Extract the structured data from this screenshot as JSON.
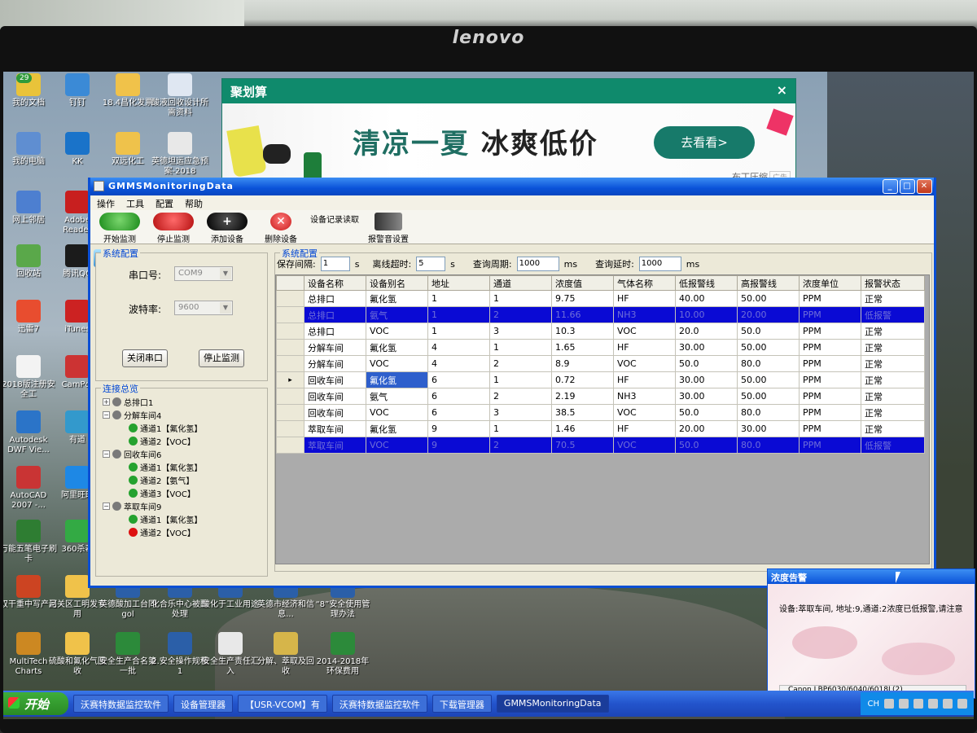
{
  "monitor": {
    "brand": "lenovo"
  },
  "desktop_icons": [
    {
      "label": "我的文档",
      "icon": "documents-icon",
      "badge": "29"
    },
    {
      "label": "钉钉",
      "icon": "dingtalk-icon"
    },
    {
      "label": "18.4昌化发票",
      "icon": "folder-icon"
    },
    {
      "label": "酸液回收设计所需资料",
      "icon": "word-doc-icon"
    },
    {
      "label": "我的电脑",
      "icon": "computer-icon"
    },
    {
      "label": "KK",
      "icon": "kk-icon"
    },
    {
      "label": "双远化工",
      "icon": "folder-icon"
    },
    {
      "label": "英德坦运应急预案-2018",
      "icon": "text-doc-icon"
    },
    {
      "label": "网上邻居",
      "icon": "network-icon"
    },
    {
      "label": "Adobe Reader",
      "icon": "pdf-icon"
    },
    {
      "label": "回收站",
      "icon": "recycle-bin-icon"
    },
    {
      "label": "腾讯QQ",
      "icon": "qq-icon"
    },
    {
      "label": "迅雷7",
      "icon": "xunlei-icon"
    },
    {
      "label": "iTunes",
      "icon": "music-icon"
    },
    {
      "label": "2018版注册安全工",
      "icon": "exam-icon"
    },
    {
      "label": "CamPdf",
      "icon": "printer-icon"
    },
    {
      "label": "Autodesk DWF Vie...",
      "icon": "autodesk-icon"
    },
    {
      "label": "有道",
      "icon": "youdao-icon"
    },
    {
      "label": "AutoCAD 2007 -...",
      "icon": "autocad-icon"
    },
    {
      "label": "阿里旺旺",
      "icon": "aliwangwang-icon"
    },
    {
      "label": "万能五笔电子刷卡",
      "icon": "wubi-icon"
    },
    {
      "label": "360杀毒",
      "icon": "antivirus-icon"
    },
    {
      "label": "双干重中写产品",
      "icon": "app-icon"
    },
    {
      "label": "河关区工明发专用",
      "icon": "folder-icon"
    },
    {
      "label": "英德酸加工台同gol",
      "icon": "word-doc-icon"
    },
    {
      "label": "化合乐中心被酸处理",
      "icon": "word-doc-icon"
    },
    {
      "label": "酸化于工业用途",
      "icon": "word-doc-icon"
    },
    {
      "label": "英德市经济和信息...",
      "icon": "word-doc-icon"
    },
    {
      "label": "“8”安全使用管理办法",
      "icon": "word-doc-icon"
    },
    {
      "label": "MultiTech Charts",
      "icon": "chart-app-icon"
    },
    {
      "label": "硫酸和氟化气回收",
      "icon": "folder-icon"
    },
    {
      "label": "安全生产合名第一批",
      "icon": "excel-icon"
    },
    {
      "label": "2.安全操作规程1",
      "icon": "word-doc-icon"
    },
    {
      "label": "安全生产责任汇入",
      "icon": "text-doc-icon"
    },
    {
      "label": "分解、萃取及回收",
      "icon": "dwg-icon"
    },
    {
      "label": "2014-2018年环保费用",
      "icon": "excel-icon"
    }
  ],
  "ad": {
    "brand": "聚划算",
    "headline_green": "清凉一夏",
    "headline_dark": "冰爽低价",
    "button": "去看看>",
    "footer": "布丁压缩",
    "badge": "广告"
  },
  "app": {
    "title": "GMMSMonitoringData",
    "menu": [
      "操作",
      "工具",
      "配置",
      "帮助"
    ],
    "toolbar": [
      {
        "label": "开始监测",
        "icon": "start-monitor-icon"
      },
      {
        "label": "停止监测",
        "icon": "stop-monitor-icon"
      },
      {
        "label": "添加设备",
        "icon": "add-device-icon"
      },
      {
        "label": "删除设备",
        "icon": "delete-device-icon"
      },
      {
        "label": "设备记录读取",
        "icon": "record-read-icon"
      },
      {
        "label": "报警音设置",
        "icon": "alarm-sound-icon"
      }
    ],
    "left_config": {
      "title": "系统配置",
      "port_label": "串口号:",
      "port_value": "COM9",
      "baud_label": "波特率:",
      "baud_value": "9600",
      "close_port_btn": "关闭串口",
      "stop_monitor_btn": "停止监测"
    },
    "tree": {
      "title": "连接总览",
      "nodes": [
        {
          "level": 1,
          "label": "总排口1",
          "status": "gray",
          "expander": "+"
        },
        {
          "level": 1,
          "label": "分解车间4",
          "status": "gray",
          "expander": "−"
        },
        {
          "level": 3,
          "label": "通道1【氟化氢】",
          "status": "green"
        },
        {
          "level": 3,
          "label": "通道2【VOC】",
          "status": "green"
        },
        {
          "level": 1,
          "label": "回收车间6",
          "status": "gray",
          "expander": "−"
        },
        {
          "level": 3,
          "label": "通道1【氟化氢】",
          "status": "green"
        },
        {
          "level": 3,
          "label": "通道2【氨气】",
          "status": "green"
        },
        {
          "level": 3,
          "label": "通道3【VOC】",
          "status": "green"
        },
        {
          "level": 1,
          "label": "萃取车间9",
          "status": "gray",
          "expander": "−"
        },
        {
          "level": 3,
          "label": "通道1【氟化氢】",
          "status": "green"
        },
        {
          "level": 3,
          "label": "通道2【VOC】",
          "status": "red"
        }
      ]
    },
    "sys_config": {
      "title": "系统配置",
      "save_interval_label": "保存间隔:",
      "save_interval": "1",
      "save_unit": "s",
      "offline_label": "离线超时:",
      "offline": "5",
      "offline_unit": "s",
      "query_period_label": "查询周期:",
      "query_period": "1000",
      "query_period_unit": "ms",
      "query_delay_label": "查询延时:",
      "query_delay": "1000",
      "query_delay_unit": "ms"
    },
    "table": {
      "columns": [
        "设备名称",
        "设备别名",
        "地址",
        "通道",
        "浓度值",
        "气体名称",
        "低报警线",
        "高报警线",
        "浓度单位",
        "报警状态"
      ],
      "rows": [
        [
          "总排口",
          "氟化氢",
          "1",
          "1",
          "9.75",
          "HF",
          "40.00",
          "50.00",
          "PPM",
          "正常"
        ],
        [
          "总排口",
          "氨气",
          "1",
          "2",
          "11.66",
          "NH3",
          "10.00",
          "20.00",
          "PPM",
          "低报警"
        ],
        [
          "总排口",
          "VOC",
          "1",
          "3",
          "10.3",
          "VOC",
          "20.0",
          "50.0",
          "PPM",
          "正常"
        ],
        [
          "分解车间",
          "氟化氢",
          "4",
          "1",
          "1.65",
          "HF",
          "30.00",
          "50.00",
          "PPM",
          "正常"
        ],
        [
          "分解车间",
          "VOC",
          "4",
          "2",
          "8.9",
          "VOC",
          "50.0",
          "80.0",
          "PPM",
          "正常"
        ],
        [
          "回收车间",
          "氟化氢",
          "6",
          "1",
          "0.72",
          "HF",
          "30.00",
          "50.00",
          "PPM",
          "正常"
        ],
        [
          "回收车间",
          "氨气",
          "6",
          "2",
          "2.19",
          "NH3",
          "30.00",
          "50.00",
          "PPM",
          "正常"
        ],
        [
          "回收车间",
          "VOC",
          "6",
          "3",
          "38.5",
          "VOC",
          "50.0",
          "80.0",
          "PPM",
          "正常"
        ],
        [
          "萃取车间",
          "氟化氢",
          "9",
          "1",
          "1.46",
          "HF",
          "20.00",
          "30.00",
          "PPM",
          "正常"
        ],
        [
          "萃取车间",
          "VOC",
          "9",
          "2",
          "70.5",
          "VOC",
          "50.0",
          "80.0",
          "PPM",
          "低报警"
        ]
      ],
      "selected_rows": [
        1,
        9
      ],
      "current_row": 5,
      "current_row_marker": "▸"
    }
  },
  "alert": {
    "title": "浓度告警",
    "message": "设备:萃取车间, 地址:9,通道:2浓度已低报警,请注意",
    "footer": "Canon LBP6030/6040/6018L(2)"
  },
  "taskbar": {
    "start": "开始",
    "tasks": [
      "沃赛特数据监控软件",
      "设备管理器",
      "【USR-VCOM】有",
      "沃赛特数据监控软件",
      "下载管理器",
      "GMMSMonitoringData"
    ],
    "active_task": 5,
    "tray_lang": "CH"
  }
}
